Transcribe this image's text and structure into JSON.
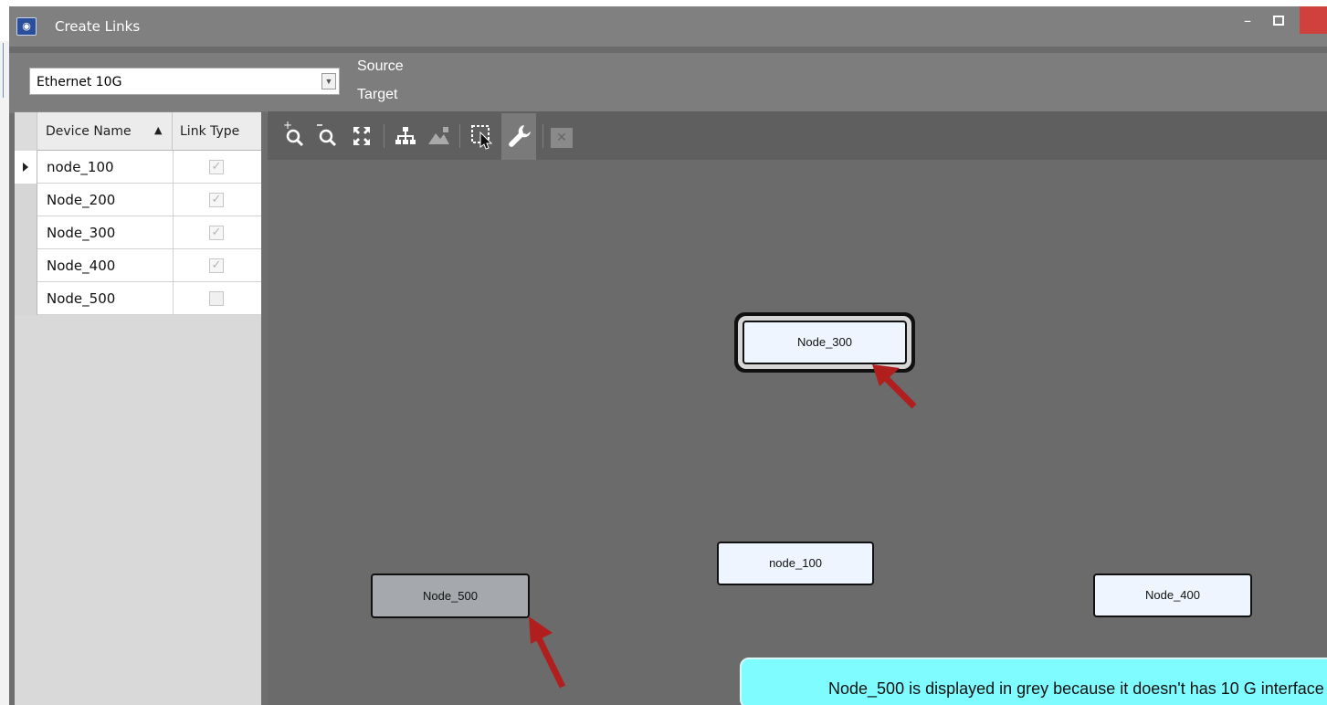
{
  "window": {
    "title": "Create Links",
    "app_icon": "app-logo-icon",
    "controls": [
      "minimize-icon",
      "maximize-icon",
      "close-icon"
    ]
  },
  "selection": {
    "link_type_value": "Ethernet 10G",
    "source_label": "Source",
    "target_label": "Target"
  },
  "device_grid": {
    "columns": [
      "Device Name",
      "Link Type"
    ],
    "sort": {
      "column": "Device Name",
      "direction": "ascending"
    },
    "rows": [
      {
        "name": "node_100",
        "link_type_checked": true,
        "current": true
      },
      {
        "name": "Node_200",
        "link_type_checked": true,
        "current": false
      },
      {
        "name": "Node_300",
        "link_type_checked": true,
        "current": false
      },
      {
        "name": "Node_400",
        "link_type_checked": true,
        "current": false
      },
      {
        "name": "Node_500",
        "link_type_checked": false,
        "current": false
      }
    ]
  },
  "toolbar": {
    "buttons": [
      "zoom-in-icon",
      "zoom-out-icon",
      "fit-to-screen-icon",
      "hierarchy-layout-icon",
      "image-icon",
      "select-region-icon",
      "wrench-icon",
      "delete-icon"
    ],
    "active": "wrench-icon",
    "disabled": [
      "image-icon",
      "delete-icon"
    ]
  },
  "canvas": {
    "nodes": [
      {
        "label": "Node_300",
        "state": "selected"
      },
      {
        "label": "node_100",
        "state": "normal"
      },
      {
        "label": "Node_500",
        "state": "grey"
      },
      {
        "label": "Node_400",
        "state": "normal"
      }
    ],
    "callout": "Node_500 is displayed in grey because it doesn't has 10 G interface",
    "colors": {
      "node_fill": "#eef5ff",
      "node_grey_fill": "#a5a8ad",
      "callout_fill": "#7ffcff",
      "arrow": "#b01e1e"
    }
  }
}
